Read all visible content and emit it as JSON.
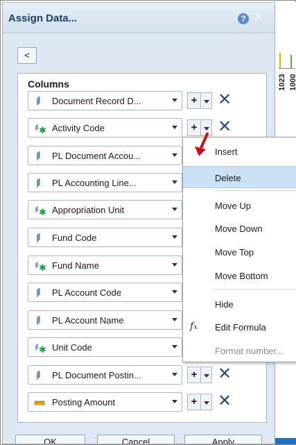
{
  "dialog": {
    "title": "Assign Data...",
    "help_icon": "?",
    "close_icon": "✕",
    "back_button": "<"
  },
  "columns": {
    "heading": "Columns",
    "items": [
      {
        "label": "Document Record D...",
        "icon": "dimension-icon",
        "has_actions": true
      },
      {
        "label": "Activity Code",
        "icon": "hierarchy-icon",
        "has_actions": true
      },
      {
        "label": "PL Document Accou...",
        "icon": "dimension-icon",
        "has_actions": false
      },
      {
        "label": "PL Accounting Line...",
        "icon": "dimension-icon",
        "has_actions": false
      },
      {
        "label": "Appropriation Unit",
        "icon": "hierarchy-icon",
        "has_actions": false
      },
      {
        "label": "Fund Code",
        "icon": "dimension-icon",
        "has_actions": false
      },
      {
        "label": "Fund Name",
        "icon": "hierarchy-icon",
        "has_actions": false
      },
      {
        "label": "PL Account Code",
        "icon": "dimension-icon",
        "has_actions": false
      },
      {
        "label": "PL Account Name",
        "icon": "dimension-icon",
        "has_actions": false
      },
      {
        "label": "Unit Code",
        "icon": "hierarchy-icon",
        "has_actions": false
      },
      {
        "label": "PL Document Postin...",
        "icon": "dimension-icon",
        "has_actions": true
      },
      {
        "label": "Posting Amount",
        "icon": "measure-icon",
        "has_actions": true
      }
    ],
    "add_label": "+",
    "remove_icon": "✕"
  },
  "context_menu": {
    "items": [
      {
        "label": "Insert",
        "state": "normal"
      },
      {
        "label": "Delete",
        "state": "hover"
      },
      {
        "label": "Move Up",
        "state": "normal"
      },
      {
        "label": "Move Down",
        "state": "normal"
      },
      {
        "label": "Move Top",
        "state": "normal"
      },
      {
        "label": "Move Bottom",
        "state": "normal"
      },
      {
        "label": "Hide",
        "state": "normal"
      },
      {
        "label": "Edit Formula",
        "state": "normal",
        "icon": "fx"
      },
      {
        "label": "Format number...",
        "state": "disabled"
      }
    ]
  },
  "footer": {
    "ok_label": "OK",
    "cancel_label": "Cancel",
    "apply_label": "Apply"
  },
  "background": {
    "tick_label_1": "1023",
    "tick_label_2": "1000"
  },
  "colors": {
    "accent": "#2b4a7e",
    "menu_hover": "#cde1f6",
    "pointer_arrow": "#c0141b"
  }
}
